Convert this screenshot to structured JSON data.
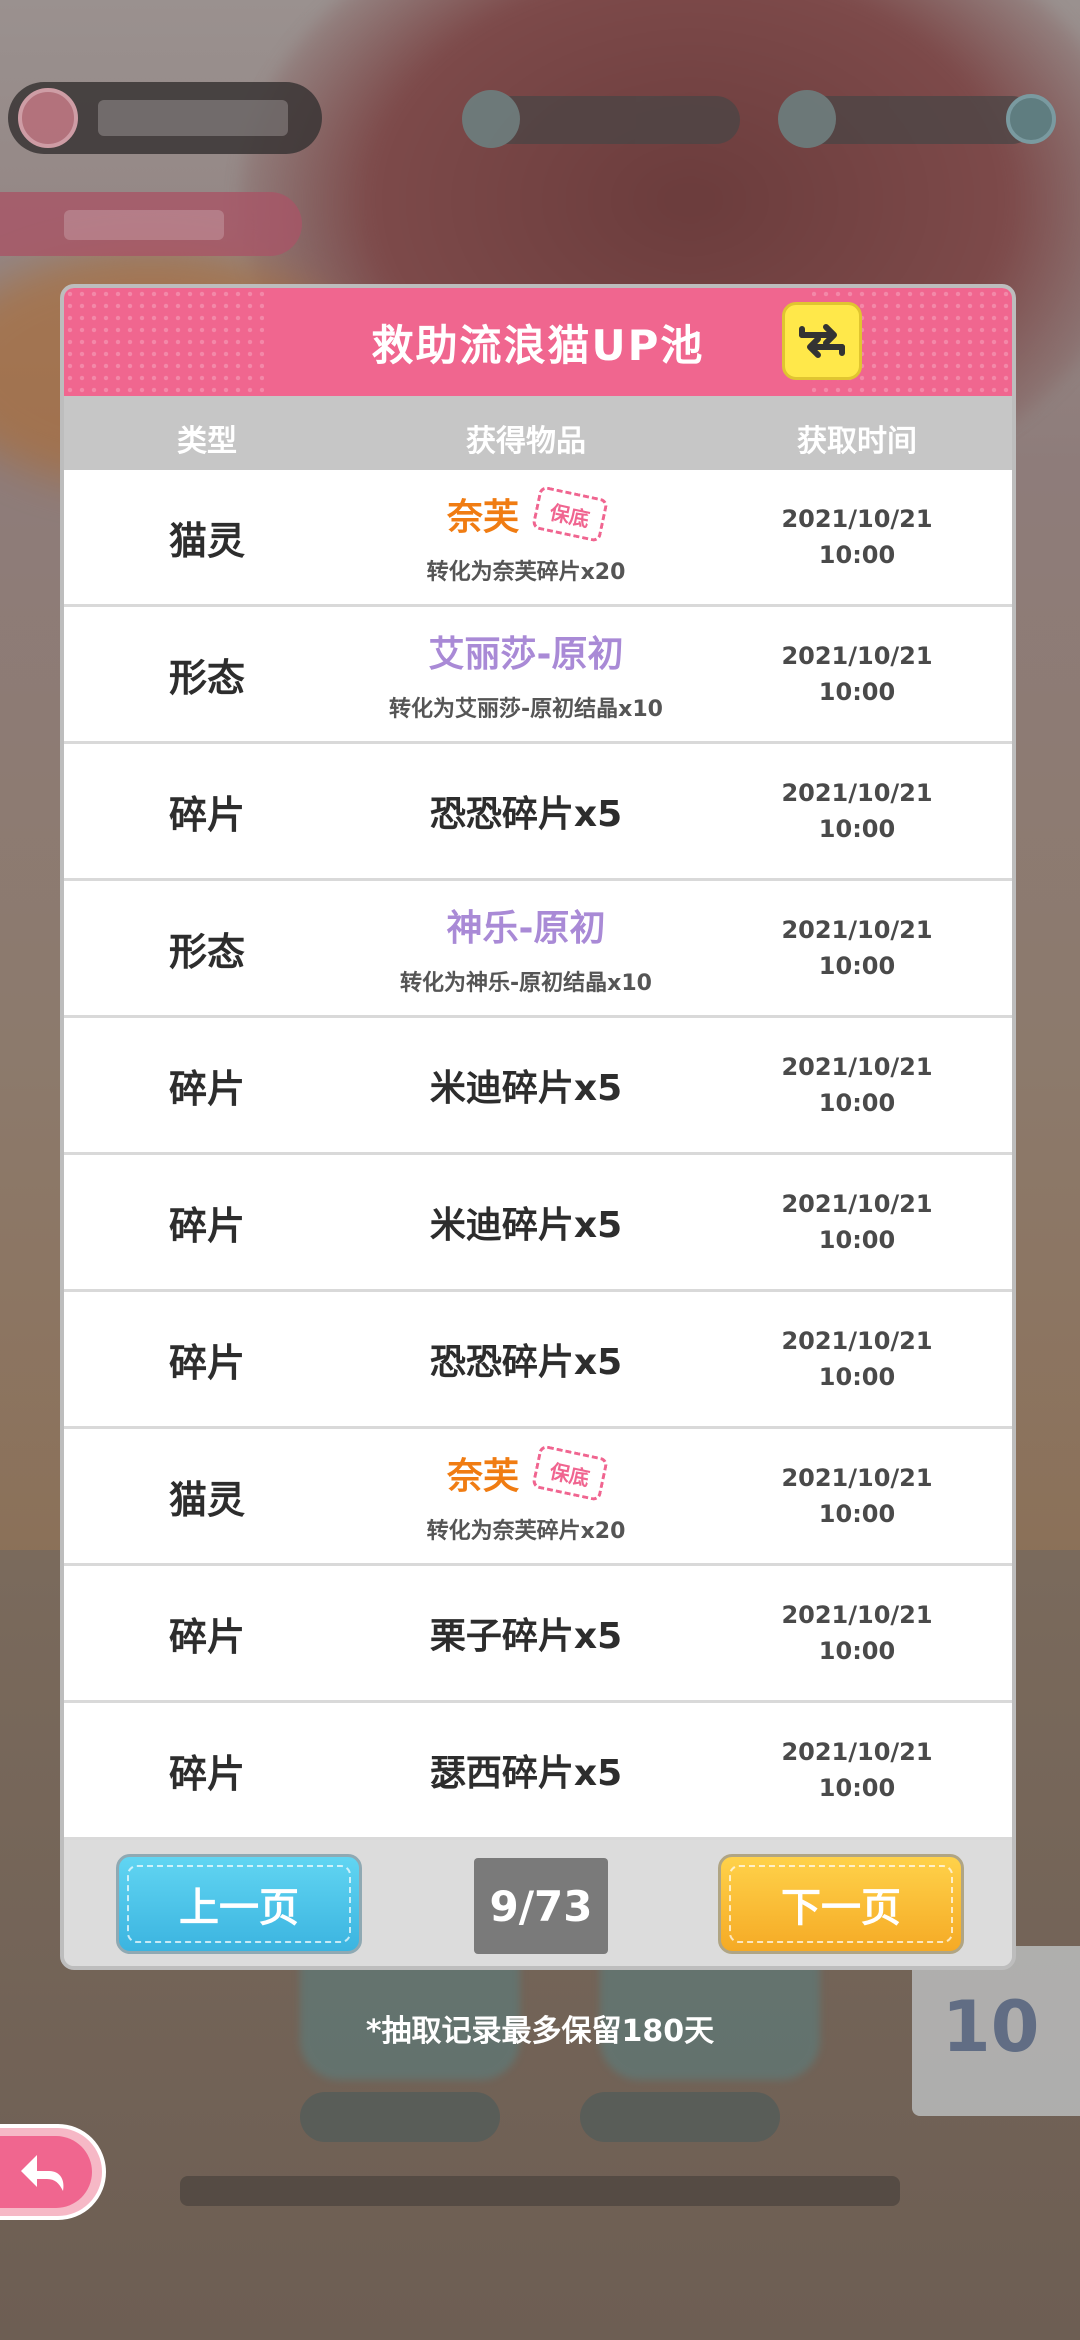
{
  "dialog": {
    "title": "救助流浪猫UP池",
    "columns": {
      "type": "类型",
      "item": "获得物品",
      "time": "获取时间"
    },
    "rows": [
      {
        "type": "猫灵",
        "item": "奈芙",
        "item_color": "orange",
        "stamp": "保底",
        "sub": "转化为奈芙碎片x20",
        "date": "2021/10/21",
        "clock": "10:00"
      },
      {
        "type": "形态",
        "item": "艾丽莎-原初",
        "item_color": "purple",
        "stamp": "",
        "sub": "转化为艾丽莎-原初结晶x10",
        "date": "2021/10/21",
        "clock": "10:00"
      },
      {
        "type": "碎片",
        "item": "恐恐碎片x5",
        "item_color": "dark",
        "stamp": "",
        "sub": "",
        "date": "2021/10/21",
        "clock": "10:00"
      },
      {
        "type": "形态",
        "item": "神乐-原初",
        "item_color": "purple",
        "stamp": "",
        "sub": "转化为神乐-原初结晶x10",
        "date": "2021/10/21",
        "clock": "10:00"
      },
      {
        "type": "碎片",
        "item": "米迪碎片x5",
        "item_color": "dark",
        "stamp": "",
        "sub": "",
        "date": "2021/10/21",
        "clock": "10:00"
      },
      {
        "type": "碎片",
        "item": "米迪碎片x5",
        "item_color": "dark",
        "stamp": "",
        "sub": "",
        "date": "2021/10/21",
        "clock": "10:00"
      },
      {
        "type": "碎片",
        "item": "恐恐碎片x5",
        "item_color": "dark",
        "stamp": "",
        "sub": "",
        "date": "2021/10/21",
        "clock": "10:00"
      },
      {
        "type": "猫灵",
        "item": "奈芙",
        "item_color": "orange",
        "stamp": "保底",
        "sub": "转化为奈芙碎片x20",
        "date": "2021/10/21",
        "clock": "10:00"
      },
      {
        "type": "碎片",
        "item": "栗子碎片x5",
        "item_color": "dark",
        "stamp": "",
        "sub": "",
        "date": "2021/10/21",
        "clock": "10:00"
      },
      {
        "type": "碎片",
        "item": "瑟西碎片x5",
        "item_color": "dark",
        "stamp": "",
        "sub": "",
        "date": "2021/10/21",
        "clock": "10:00"
      }
    ],
    "pagination": {
      "prev_label": "上一页",
      "next_label": "下一页",
      "page": "9/73"
    }
  },
  "note": "*抽取记录最多保留180天",
  "icons": {
    "switch": "swap-arrows-icon",
    "back": "back-arrow-icon"
  },
  "colors": {
    "header": "#f0668f",
    "orange": "#f07c12",
    "purple": "#a98ad6",
    "prev": "#3bb4e0",
    "next": "#f5aa25",
    "switch": "#ffe84a"
  }
}
